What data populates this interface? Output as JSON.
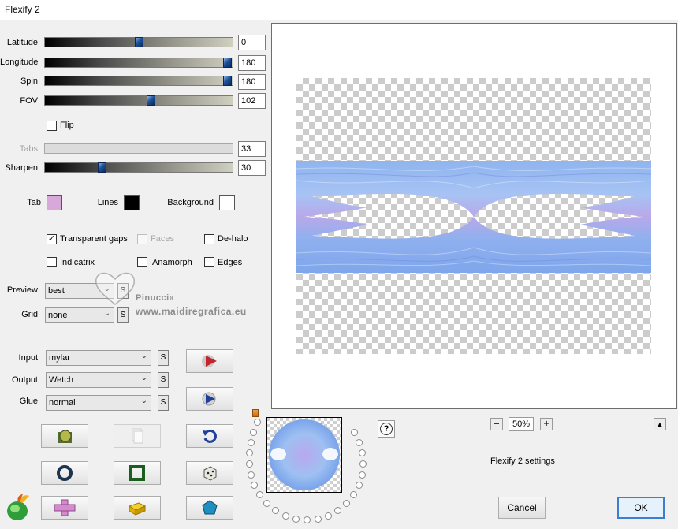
{
  "window": {
    "title": "Flexify 2"
  },
  "sliders": [
    {
      "label": "Latitude",
      "value": "0",
      "position": 0.5,
      "disabled": false
    },
    {
      "label": "Longitude",
      "value": "180",
      "position": 1.0,
      "disabled": false
    },
    {
      "label": "Spin",
      "value": "180",
      "position": 1.0,
      "disabled": false
    },
    {
      "label": "FOV",
      "value": "102",
      "position": 0.57,
      "disabled": false
    },
    {
      "label": "Tabs",
      "value": "33",
      "position": null,
      "disabled": true
    },
    {
      "label": "Sharpen",
      "value": "30",
      "position": 0.3,
      "disabled": false
    }
  ],
  "flip": {
    "label": "Flip",
    "checked": false
  },
  "colors": {
    "tab": {
      "label": "Tab",
      "color": "#d7a8d9"
    },
    "lines": {
      "label": "Lines",
      "color": "#000000"
    },
    "background": {
      "label": "Background",
      "color": "#ffffff"
    }
  },
  "options": {
    "transparent_gaps": {
      "label": "Transparent gaps",
      "checked": true
    },
    "faces": {
      "label": "Faces",
      "checked": false,
      "disabled": true
    },
    "de_halo": {
      "label": "De-halo",
      "checked": false
    },
    "indicatrix": {
      "label": "Indicatrix",
      "checked": false
    },
    "anamorph": {
      "label": "Anamorph",
      "checked": false
    },
    "edges": {
      "label": "Edges",
      "checked": false
    }
  },
  "preview": {
    "label": "Preview",
    "value": "best"
  },
  "grid": {
    "label": "Grid",
    "value": "none"
  },
  "input": {
    "label": "Input",
    "value": "mylar"
  },
  "output": {
    "label": "Output",
    "value": "Wetch"
  },
  "glue": {
    "label": "Glue",
    "value": "normal"
  },
  "s_label": "S",
  "watermark": {
    "name": "Pinuccia",
    "site": "www.maidiregrafica.eu"
  },
  "zoom": {
    "value": "50%",
    "minus": "−",
    "plus": "+"
  },
  "settings_text": "Flexify 2 settings",
  "help": "?",
  "collapse": "▲",
  "buttons": {
    "cancel": "Cancel",
    "ok": "OK"
  },
  "check_glyph": "✓",
  "select_arrow": "⌄"
}
